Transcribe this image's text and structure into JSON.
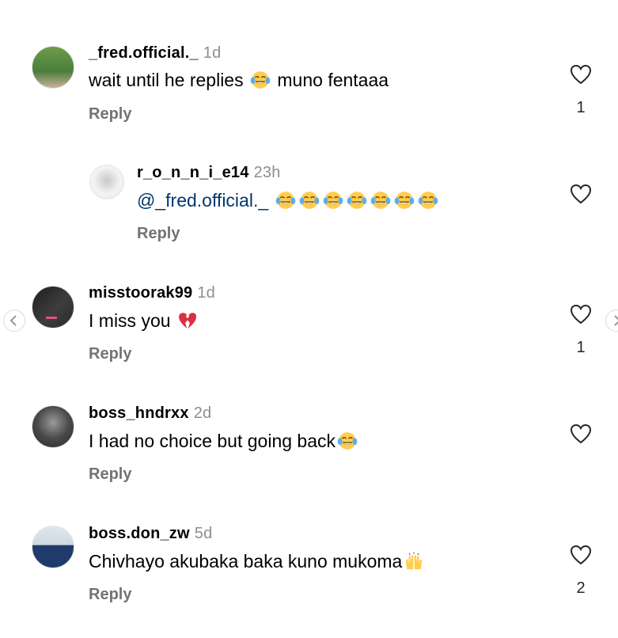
{
  "reply_label": "Reply",
  "comments": [
    {
      "username": "_fred.official._",
      "time": "1d",
      "text_before": "wait until he replies",
      "emoji": "joy-emoji",
      "text_after": "muno fentaaa",
      "likes": "1",
      "avatar_colors": [
        "#4a7d3a",
        "#c9b29a"
      ]
    },
    {
      "username": "r_o_n_n_i_e14",
      "time": "23h",
      "mention": "@_fred.official._",
      "emoji_count": 7,
      "emoji": "joy-emoji",
      "avatar_colors": [
        "#f2f2f2",
        "#8a8a8a"
      ]
    },
    {
      "username": "misstoorak99",
      "time": "1d",
      "text": "I miss you",
      "emoji": "broken-heart-emoji",
      "likes": "1",
      "avatar_colors": [
        "#2b2b2b",
        "#e0557a"
      ]
    },
    {
      "username": "boss_hndrxx",
      "time": "2d",
      "text": "I had no choice but going back",
      "emoji": "joy-emoji",
      "avatar_colors": [
        "#3a3a3a",
        "#9a9a9a"
      ]
    },
    {
      "username": "boss.don_zw",
      "time": "5d",
      "text": "Chivhayo akubaka baka kuno mukoma",
      "emoji": "raising-hands-emoji",
      "likes": "2",
      "avatar_colors": [
        "#cfd8e3",
        "#1f3b6b"
      ]
    }
  ],
  "colors": {
    "secondary_text": "#737373",
    "timestamp": "#8e8e8e",
    "mention": "#00376b",
    "joy_face": "#ffcc4d",
    "tear": "#5dadec",
    "broken_heart": "#dd2e44"
  }
}
